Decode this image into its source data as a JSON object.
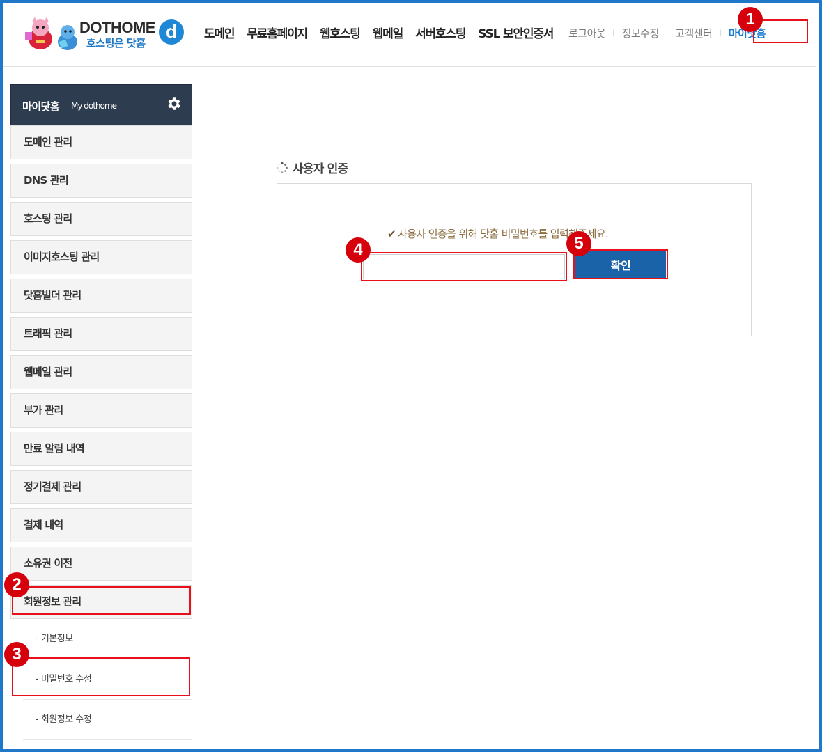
{
  "logo": {
    "brand": "DOTHOME",
    "tagline": "호스팅은 닷홈",
    "mark": "d"
  },
  "main_nav": [
    "도메인",
    "무료홈페이지",
    "웹호스팅",
    "웹메일",
    "서버호스팅",
    "SSL 보안인증서"
  ],
  "util_nav": {
    "logout": "로그아웃",
    "edit_info": "정보수정",
    "support": "고객센터",
    "mydothome": "마이닷홈",
    "separator": "|"
  },
  "sidebar": {
    "title": "마이닷홈",
    "subtitle": "My dothome",
    "items": [
      "도메인 관리",
      "DNS 관리",
      "호스팅 관리",
      "이미지호스팅 관리",
      "닷홈빌더 관리",
      "트래픽 관리",
      "웹메일 관리",
      "부가 관리",
      "만료 알림 내역",
      "정기결제 관리",
      "결제 내역",
      "소유권 이전",
      "회원정보 관리"
    ],
    "sub_items": [
      "- 기본정보",
      "- 비밀번호 수정",
      "- 회원정보 수정"
    ]
  },
  "auth": {
    "title": "사용자 인증",
    "message": "사용자 인증을 위해 닷홈 비밀번호를 입력해주세요.",
    "password_value": "",
    "confirm_label": "확인"
  },
  "annotations": [
    "1",
    "2",
    "3",
    "4",
    "5"
  ],
  "colors": {
    "frame": "#1f78c8",
    "sidebar_head": "#2e3c4f",
    "button": "#1b63a8",
    "highlight": "#e8101b",
    "badge": "#d6000d",
    "link_active": "#1a7ad0"
  }
}
